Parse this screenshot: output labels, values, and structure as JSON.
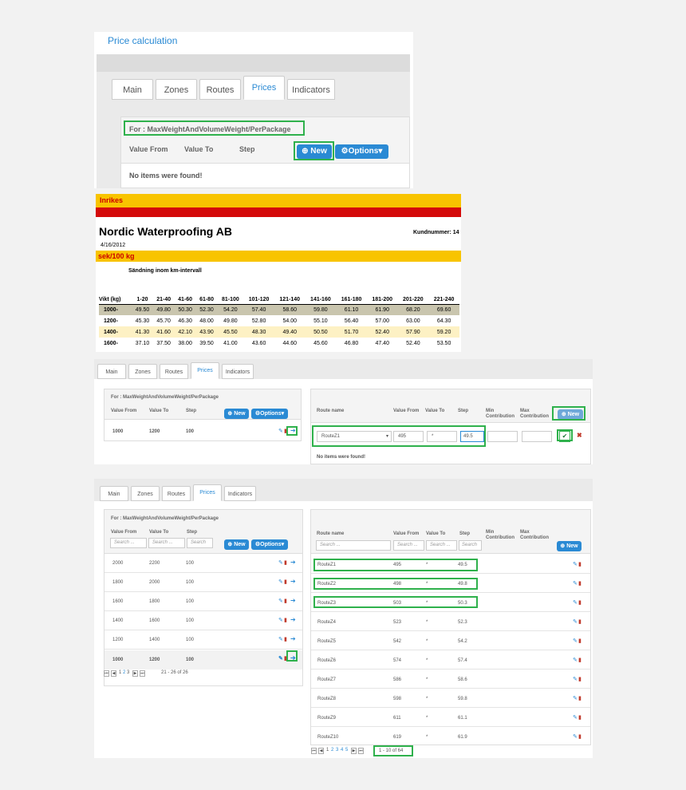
{
  "panel1": {
    "title": "Price calculation",
    "tabs": [
      "Main",
      "Zones",
      "Routes",
      "Prices",
      "Indicators"
    ],
    "for_label": "For : MaxWeightAndVolumeWeight/PerPackage",
    "cols": [
      "Value From",
      "Value To",
      "Step"
    ],
    "new_label": "New",
    "options_label": "Options",
    "empty": "No items were found!"
  },
  "panel2": {
    "banner": "Inrikes",
    "company": "Nordic Waterproofing AB",
    "customer_label": "Kundnummer: 14",
    "date": "4/16/2012",
    "unit": "sek/100 kg",
    "subtitle": "Sändning inom km-intervall",
    "headers": [
      "Vikt (kg)",
      "1-20",
      "21-40",
      "41-60",
      "61-80",
      "81-100",
      "101-120",
      "121-140",
      "141-160",
      "161-180",
      "181-200",
      "201-220",
      "221-240"
    ],
    "rows": [
      {
        "weight": "1000-",
        "values": [
          "49.50",
          "49.80",
          "50.30",
          "52.30",
          "54.20",
          "57.40",
          "58.60",
          "59.80",
          "61.10",
          "61.90",
          "68.20",
          "69.60"
        ]
      },
      {
        "weight": "1200-",
        "values": [
          "45.30",
          "45.70",
          "46.30",
          "48.00",
          "49.80",
          "52.80",
          "54.00",
          "55.10",
          "56.40",
          "57.00",
          "63.00",
          "64.30"
        ]
      },
      {
        "weight": "1400-",
        "values": [
          "41.30",
          "41.60",
          "42.10",
          "43.90",
          "45.50",
          "48.30",
          "49.40",
          "50.50",
          "51.70",
          "52.40",
          "57.90",
          "59.20"
        ]
      },
      {
        "weight": "1600-",
        "values": [
          "37.10",
          "37.50",
          "38.00",
          "39.50",
          "41.00",
          "43.60",
          "44.60",
          "45.60",
          "46.80",
          "47.40",
          "52.40",
          "53.50"
        ]
      }
    ]
  },
  "panel3": {
    "tabs": [
      "Main",
      "Zones",
      "Routes",
      "Prices",
      "Indicators"
    ],
    "for_label": "For : MaxWeightAndVolumeWeight/PerPackage",
    "cols": [
      "Value From",
      "Value To",
      "Step"
    ],
    "new_label": "New",
    "options_label": "Options",
    "row": [
      "1000",
      "1200",
      "100"
    ],
    "route_cols": [
      "Route name",
      "Value From",
      "Value To",
      "Step",
      "Min Contribution",
      "Max Contribution"
    ],
    "edit": {
      "route": "RouteZ1",
      "from": "495",
      "to": "*",
      "step": "49.5"
    },
    "empty": "No items were found!"
  },
  "panel4": {
    "tabs": [
      "Main",
      "Zones",
      "Routes",
      "Prices",
      "Indicators"
    ],
    "for_label": "For : MaxWeightAndVolumeWeight/PerPackage",
    "cols": [
      "Value From",
      "Value To",
      "Step"
    ],
    "search_placeholder": "Search ...",
    "search_short": "Search",
    "new_label": "New",
    "options_label": "Options",
    "left_rows": [
      [
        "2000",
        "2200",
        "100"
      ],
      [
        "1800",
        "2000",
        "100"
      ],
      [
        "1600",
        "1800",
        "100"
      ],
      [
        "1400",
        "1600",
        "100"
      ],
      [
        "1200",
        "1400",
        "100"
      ],
      [
        "1000",
        "1200",
        "100"
      ]
    ],
    "left_pager_pages": [
      "1",
      "2",
      "3"
    ],
    "left_pager_info": "21 - 26 of 26",
    "route_cols": [
      "Route name",
      "Value From",
      "Value To",
      "Step",
      "Min Contribution",
      "Max Contribution"
    ],
    "right_rows": [
      [
        "RouteZ1",
        "495",
        "*",
        "49.5"
      ],
      [
        "RouteZ2",
        "498",
        "*",
        "49.8"
      ],
      [
        "RouteZ3",
        "503",
        "*",
        "50.3"
      ],
      [
        "RouteZ4",
        "523",
        "*",
        "52.3"
      ],
      [
        "RouteZ5",
        "542",
        "*",
        "54.2"
      ],
      [
        "RouteZ6",
        "574",
        "*",
        "57.4"
      ],
      [
        "RouteZ7",
        "586",
        "*",
        "58.6"
      ],
      [
        "RouteZ8",
        "598",
        "*",
        "59.8"
      ],
      [
        "RouteZ9",
        "611",
        "*",
        "61.1"
      ],
      [
        "RouteZ10",
        "619",
        "*",
        "61.9"
      ]
    ],
    "right_pager_pages": [
      "1",
      "2",
      "3",
      "4",
      "5"
    ],
    "right_pager_info": "1 - 10 of 64"
  },
  "colors": {
    "accent": "#2a8ad4",
    "highlight_green": "#2fb14c",
    "banner_yellow": "#f8c400",
    "banner_red": "#d40a0a",
    "row_olive": "#c9c5ae",
    "row_cream": "#fdf1c4"
  }
}
